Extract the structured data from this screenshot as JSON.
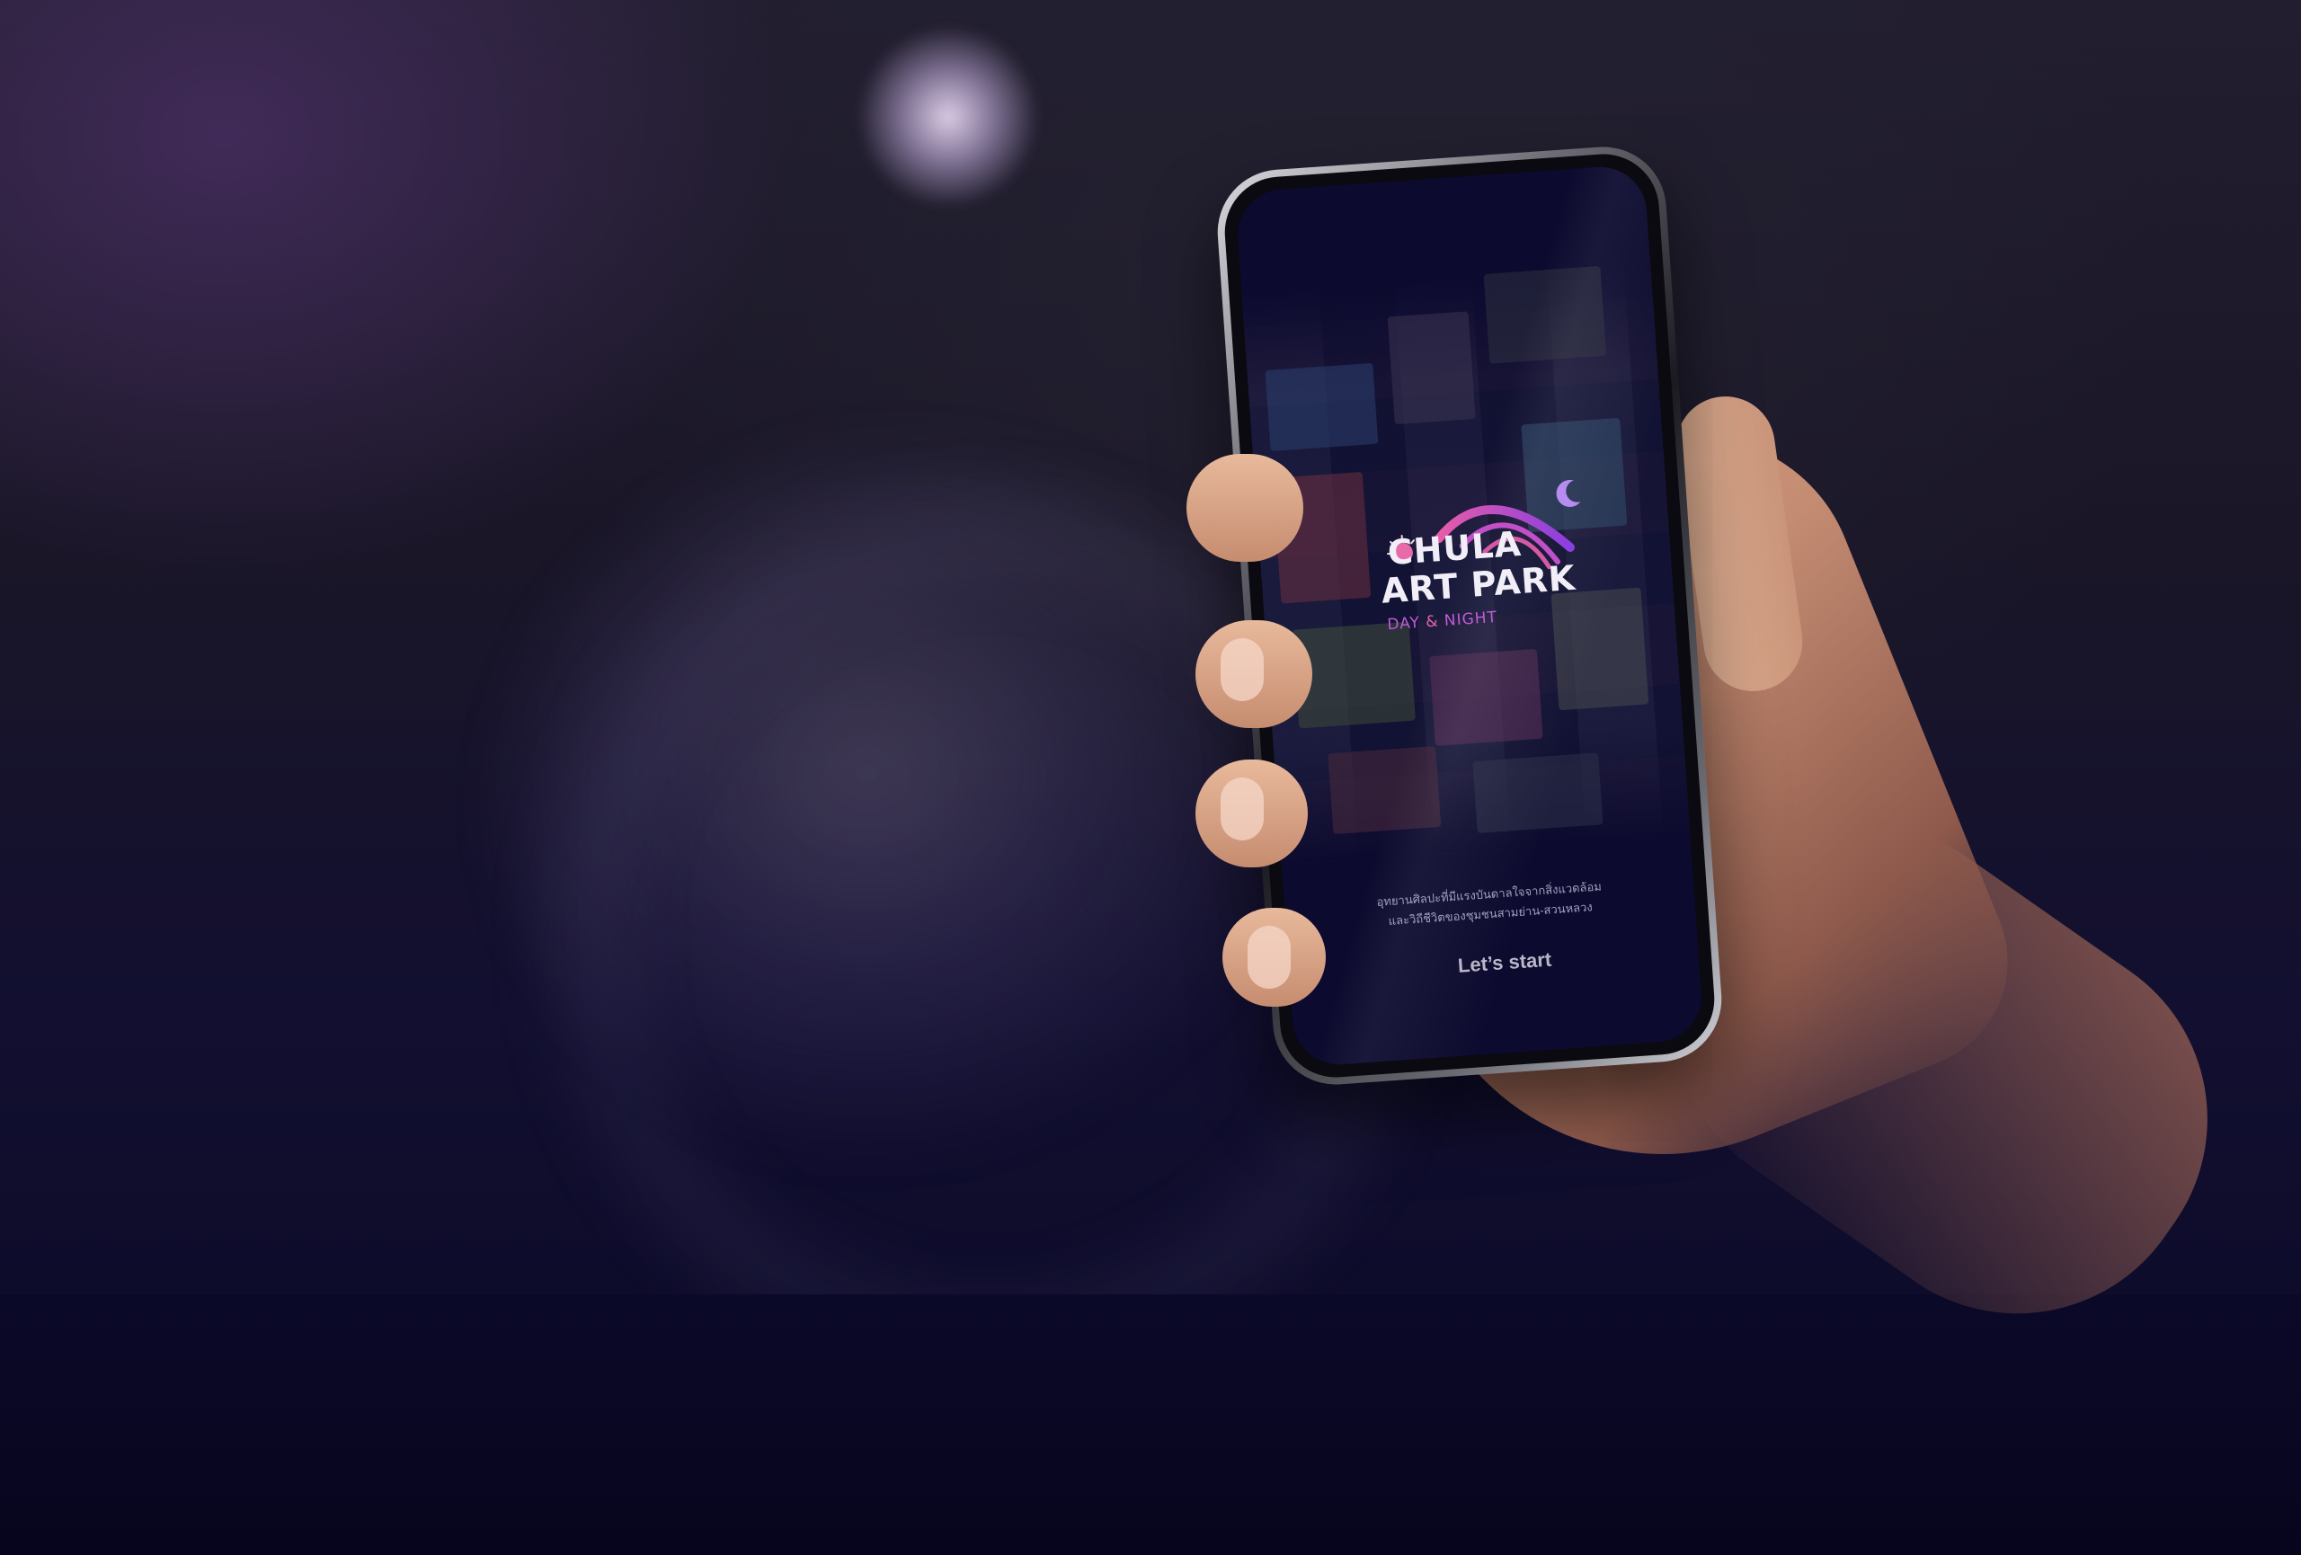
{
  "app": {
    "logo": {
      "line1": "CHULA",
      "line2": "ART PARK",
      "tag_day": "DAY",
      "tag_amp": "&",
      "tag_night": "NIGHT"
    },
    "tagline": [
      "อุทยานศิลปะที่มีแรงบันดาลใจจากสิ่งแวดล้อม",
      "และวิถีชีวิตของชุมชนสามย่าน-สวนหลวง"
    ],
    "start_label": "Let’s start"
  },
  "colors": {
    "screen_bg": "#0c0a2e",
    "logo_text": "#f2eef8",
    "accent_purple": "#a64bd8",
    "accent_pink": "#e066a8",
    "moon": "#b78cf0"
  },
  "icons": [
    "sun-icon",
    "moon-icon",
    "arch-logo-icon"
  ]
}
